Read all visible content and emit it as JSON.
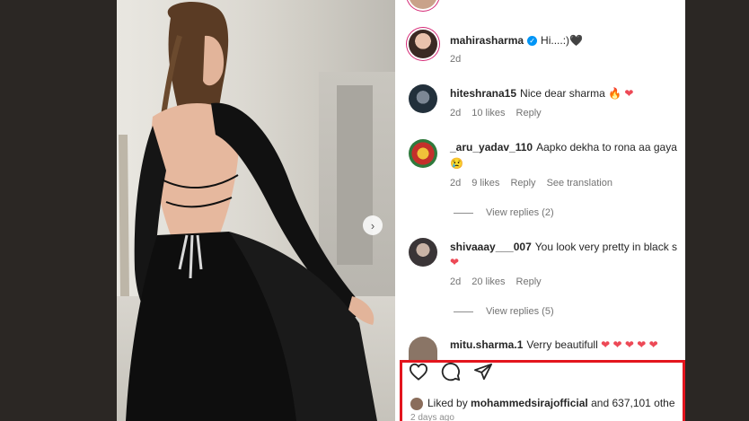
{
  "post": {
    "carousel_next_symbol": "›"
  },
  "comments": [
    {
      "username": "mahirasharma",
      "verified": true,
      "text": "Hi....:)",
      "emoji": "🖤",
      "time": "2d"
    },
    {
      "username": "hiteshrana15",
      "text": "Nice dear sharma",
      "emoji": "🔥",
      "emoji2": "❤",
      "time": "2d",
      "likes": "10 likes",
      "reply": "Reply"
    },
    {
      "username": "_aru_yadav_110",
      "text": "Aapko dekha to rona aa gaya",
      "emoji": "😢",
      "time": "2d",
      "likes": "9 likes",
      "reply": "Reply",
      "translate": "See translation",
      "view_replies": "View replies (2)"
    },
    {
      "username": "shivaaay___007",
      "text": "You look very pretty in black s",
      "emoji": "❤",
      "time": "2d",
      "likes": "20 likes",
      "reply": "Reply",
      "view_replies": "View replies (5)"
    },
    {
      "username": "mitu.sharma.1",
      "text": "Verry beautifull",
      "emoji": "❤ ❤ ❤ ❤ ❤"
    }
  ],
  "actions": {
    "like_icon": "heart-icon",
    "comment_icon": "comment-icon",
    "share_icon": "share-icon"
  },
  "likes_summary": {
    "prefix": "Liked by",
    "user": "mohammedsirajofficial",
    "suffix": "and 637,101 othe"
  },
  "posted": "2 days ago",
  "colors": {
    "highlight_border": "#e3151e",
    "verified_blue": "#0095f6",
    "heart_red": "#ed4956",
    "meta_gray": "#737373"
  }
}
